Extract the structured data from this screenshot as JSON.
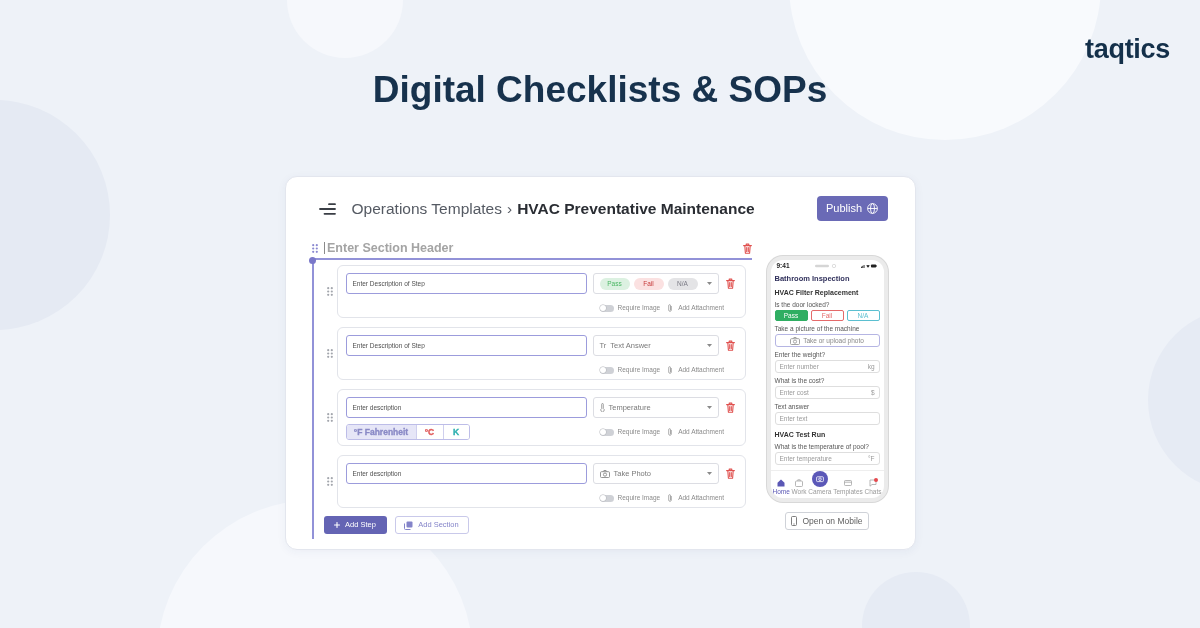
{
  "brand": {
    "logo": "taqtics"
  },
  "headline": "Digital Checklists & SOPs",
  "editor": {
    "breadcrumb": {
      "parent": "Operations Templates",
      "separator": "›",
      "current": "HVAC Preventative Maintenance"
    },
    "publish_button": "Publish",
    "section": {
      "placeholder": "Enter Section Header",
      "focused": true
    },
    "steps": [
      {
        "kind": "choice",
        "placeholder": "Enter Description of Step",
        "options": [
          {
            "label": "Pass",
            "color": "#dcf1e1"
          },
          {
            "label": "Fail",
            "color": "#fbe1e1"
          },
          {
            "label": "N/A",
            "color": "#e4e4e6"
          }
        ],
        "require_image": false,
        "require_image_label": "Require Image",
        "attachment_label": "Add Attachment"
      },
      {
        "kind": "text",
        "placeholder": "Enter Description of Step",
        "type_glyph": "Tr",
        "answer_type": "Text Answer",
        "require_image": false,
        "require_image_label": "Require Image",
        "attachment_label": "Add Attachment"
      },
      {
        "kind": "temperature",
        "placeholder": "Enter description",
        "answer_type": "Temperature",
        "units": [
          {
            "label": "°F Fahrenheit",
            "selected": true,
            "color": "#8a8ac6"
          },
          {
            "label": "°C",
            "selected": false,
            "color": "#e05a5a"
          },
          {
            "label": "K",
            "selected": false,
            "color": "#2fb0b0"
          }
        ],
        "require_image": false,
        "require_image_label": "Require Image",
        "attachment_label": "Add Attachment"
      },
      {
        "kind": "photo",
        "placeholder": "Enter description",
        "answer_type": "Take Photo",
        "require_image": false,
        "require_image_label": "Require Image",
        "attachment_label": "Add Attachment"
      }
    ],
    "add_step_button": "Add Step",
    "add_section_button": "Add Section"
  },
  "mobile_preview": {
    "time": "9:41",
    "title": "Bathroom Inspection",
    "sections": [
      {
        "heading": "HVAC Filter Replacement",
        "questions": [
          {
            "kind": "choice",
            "prompt": "Is the door locked?",
            "options": [
              {
                "label": "Pass",
                "selected": true,
                "color": "#2fae62"
              },
              {
                "label": "Fail",
                "selected": false,
                "color": "#e46a6a"
              },
              {
                "label": "N/A",
                "selected": false,
                "color": "#5bbfd0"
              }
            ]
          },
          {
            "kind": "photo",
            "prompt": "Take a picture of the machine",
            "placeholder": "Take or upload photo"
          },
          {
            "kind": "input",
            "prompt": "Enter the weight?",
            "placeholder": "Enter number",
            "suffix": "kg"
          },
          {
            "kind": "input",
            "prompt": "What is the cost?",
            "placeholder": "Enter cost",
            "suffix": "$"
          },
          {
            "kind": "input",
            "prompt": "Text answer",
            "placeholder": "Enter text"
          }
        ]
      },
      {
        "heading": "HVAC Test Run",
        "questions": [
          {
            "kind": "input",
            "prompt": "What is the temperature of pool?",
            "placeholder": "Enter temperature",
            "suffix": "°F"
          }
        ]
      }
    ],
    "nav": [
      {
        "kind": "tab",
        "label": "Home",
        "selected": true,
        "badge": false
      },
      {
        "kind": "tab",
        "label": "Work",
        "selected": false,
        "badge": false
      },
      {
        "kind": "action",
        "label": "Camera",
        "selected": false,
        "badge": false
      },
      {
        "kind": "tab",
        "label": "Templates",
        "selected": false,
        "badge": false
      },
      {
        "kind": "tab",
        "label": "Chats",
        "selected": false,
        "badge": true
      }
    ],
    "open_button": "Open on Mobile"
  }
}
